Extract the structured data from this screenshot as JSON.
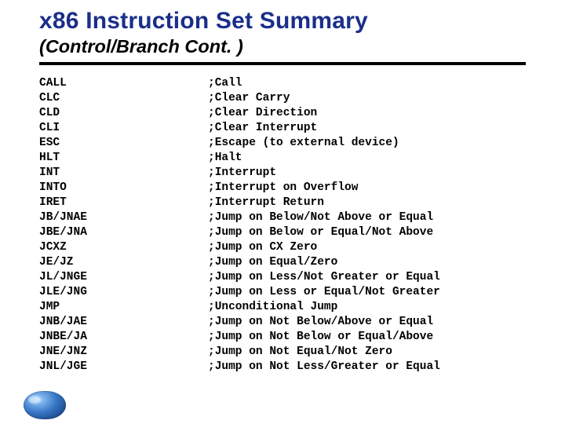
{
  "title": "x86 Instruction Set Summary",
  "subtitle": "(Control/Branch Cont. )",
  "instructions": [
    {
      "mnemonic": "CALL",
      "desc": ";Call"
    },
    {
      "mnemonic": "CLC",
      "desc": ";Clear Carry"
    },
    {
      "mnemonic": "CLD",
      "desc": ";Clear Direction"
    },
    {
      "mnemonic": "CLI",
      "desc": ";Clear Interrupt"
    },
    {
      "mnemonic": "ESC",
      "desc": ";Escape (to external device)"
    },
    {
      "mnemonic": "HLT",
      "desc": ";Halt"
    },
    {
      "mnemonic": "INT",
      "desc": ";Interrupt"
    },
    {
      "mnemonic": "INTO",
      "desc": ";Interrupt on Overflow"
    },
    {
      "mnemonic": "IRET",
      "desc": ";Interrupt Return"
    },
    {
      "mnemonic": "JB/JNAE",
      "desc": ";Jump on Below/Not Above or Equal"
    },
    {
      "mnemonic": "JBE/JNA",
      "desc": ";Jump on Below or Equal/Not Above"
    },
    {
      "mnemonic": "JCXZ",
      "desc": ";Jump on CX Zero"
    },
    {
      "mnemonic": "JE/JZ",
      "desc": ";Jump on Equal/Zero"
    },
    {
      "mnemonic": "JL/JNGE",
      "desc": ";Jump on Less/Not Greater or Equal"
    },
    {
      "mnemonic": "JLE/JNG",
      "desc": ";Jump on Less or Equal/Not Greater"
    },
    {
      "mnemonic": "JMP",
      "desc": ";Unconditional Jump"
    },
    {
      "mnemonic": "JNB/JAE",
      "desc": ";Jump on Not Below/Above or Equal"
    },
    {
      "mnemonic": "JNBE/JA",
      "desc": ";Jump on Not Below or Equal/Above"
    },
    {
      "mnemonic": "JNE/JNZ",
      "desc": ";Jump on Not Equal/Not Zero"
    },
    {
      "mnemonic": "JNL/JGE",
      "desc": ";Jump on Not Less/Greater or Equal"
    }
  ]
}
